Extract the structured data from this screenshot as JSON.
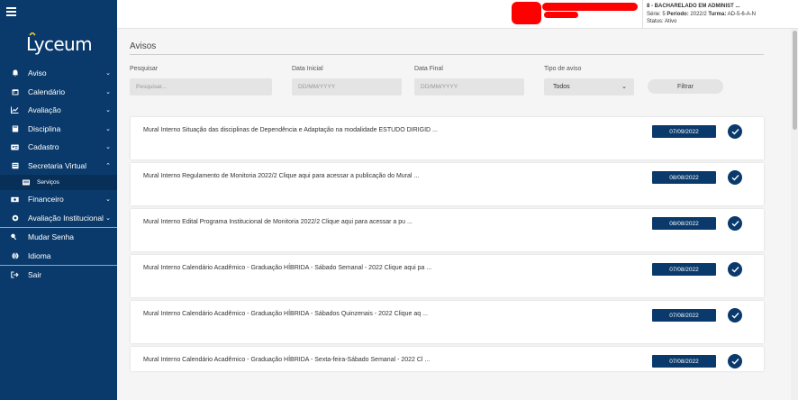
{
  "sidebar": {
    "logo_text": "Lyceum",
    "items": [
      {
        "label": "Aviso",
        "icon": "bell-icon",
        "chevron": "⌄"
      },
      {
        "label": "Calendário",
        "icon": "calendar-icon",
        "chevron": "⌄"
      },
      {
        "label": "Avaliação",
        "icon": "chart-line-icon",
        "chevron": "⌄"
      },
      {
        "label": "Disciplina",
        "icon": "book-icon",
        "chevron": "⌄"
      },
      {
        "label": "Cadastro",
        "icon": "id-card-icon",
        "chevron": "⌄"
      },
      {
        "label": "Secretaria Virtual",
        "icon": "document-icon",
        "chevron": "⌃"
      },
      {
        "label": "Serviços",
        "icon": "list-icon"
      },
      {
        "label": "Financeiro",
        "icon": "money-icon",
        "chevron": "⌄"
      },
      {
        "label": "Avaliação Institucional",
        "icon": "cog-icon",
        "chevron": "⌄"
      },
      {
        "label": "Mudar Senha",
        "icon": "key-icon"
      },
      {
        "label": "Idioma",
        "icon": "globe-icon"
      },
      {
        "label": "Sair",
        "icon": "exit-icon"
      }
    ]
  },
  "header": {
    "course": "8 - BACHARELADO EM ADMINIST ...",
    "serie_label": "Série:",
    "serie": "5",
    "periodo_label": "Período:",
    "periodo": "2022/2",
    "turma_label": "Turma:",
    "turma": "AD-5-6-A-N",
    "status_label": "Status:",
    "status": "Ativo"
  },
  "main": {
    "title": "Avisos",
    "filters": {
      "search_label": "Pesquisar",
      "search_placeholder": "Pesquisar...",
      "start_label": "Data Inicial",
      "start_placeholder": "DD/MM/YYYY",
      "end_label": "Data Final",
      "end_placeholder": "DD/MM/YYYY",
      "type_label": "Tipo de aviso",
      "type_value": "Todos",
      "filter_button": "Filtrar"
    },
    "notices": [
      {
        "text": "Mural Interno Situação das disciplinas de Dependência e Adaptação na modalidade ESTUDO DIRIGID ...",
        "date": "07/09/2022"
      },
      {
        "text": "Mural Interno Regulamento de Monitoria 2022/2 Clique aqui para acessar a publicação do Mural ...",
        "date": "08/08/2022"
      },
      {
        "text": "Mural Interno Edital Programa Institucional de Monitoria 2022/2 Clique aqui para acessar a pu ...",
        "date": "08/08/2022"
      },
      {
        "text": "Mural Interno Calendário Acadêmico - Graduação HÍBRIDA - Sábado Semanal - 2022 Clique aqui pa ...",
        "date": "07/08/2022"
      },
      {
        "text": "Mural Interno Calendário Acadêmico - Graduação HÍBRIDA - Sábados Quinzenais - 2022 Clique aq ...",
        "date": "07/08/2022"
      },
      {
        "text": "Mural Interno Calendário Acadêmico - Graduação HÍBRIDA - Sexta-feira-Sábado Semanal - 2022 Cl ...",
        "date": "07/08/2022"
      }
    ]
  },
  "colors": {
    "sidebar_bg": "#0a3a6b",
    "accent_gold": "#f2c230",
    "date_badge": "#0a3a6b"
  }
}
